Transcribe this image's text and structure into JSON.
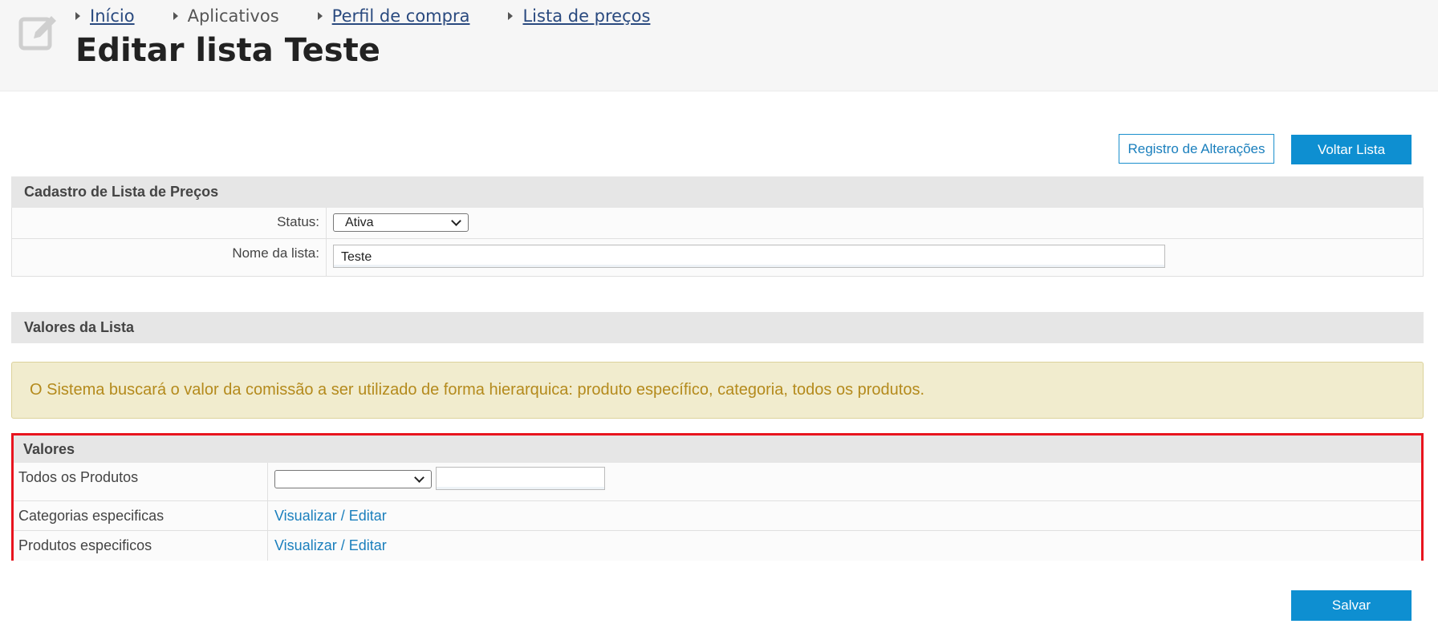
{
  "breadcrumb": [
    {
      "label": "Início",
      "link": true
    },
    {
      "label": "Aplicativos",
      "link": false
    },
    {
      "label": "Perfil de compra",
      "link": true
    },
    {
      "label": "Lista de preços",
      "link": true
    }
  ],
  "page_title": "Editar lista Teste",
  "buttons": {
    "history": "Registro de Alterações",
    "back": "Voltar Lista",
    "save": "Salvar"
  },
  "cadastro": {
    "title": "Cadastro de Lista de Preços",
    "status_label": "Status:",
    "status_value": "Ativa",
    "name_label": "Nome da lista:",
    "name_value": "Teste"
  },
  "valores_lista": {
    "title": "Valores da Lista",
    "alert": "O Sistema buscará o valor da comissão a ser utilizado de forma hierarquica: produto específico, categoria, todos os produtos."
  },
  "valores": {
    "title": "Valores",
    "rows": [
      {
        "label": "Todos os Produtos",
        "select_value": "",
        "input_value": ""
      },
      {
        "label": "Categorias especificas",
        "link": "Visualizar / Editar"
      },
      {
        "label": "Produtos especificos",
        "link": "Visualizar / Editar"
      }
    ]
  },
  "colors": {
    "primary": "#0e8fd1",
    "alert_text": "#b48a1c",
    "highlight_border": "#e8141e"
  },
  "icons": {
    "header": "edit-icon"
  }
}
